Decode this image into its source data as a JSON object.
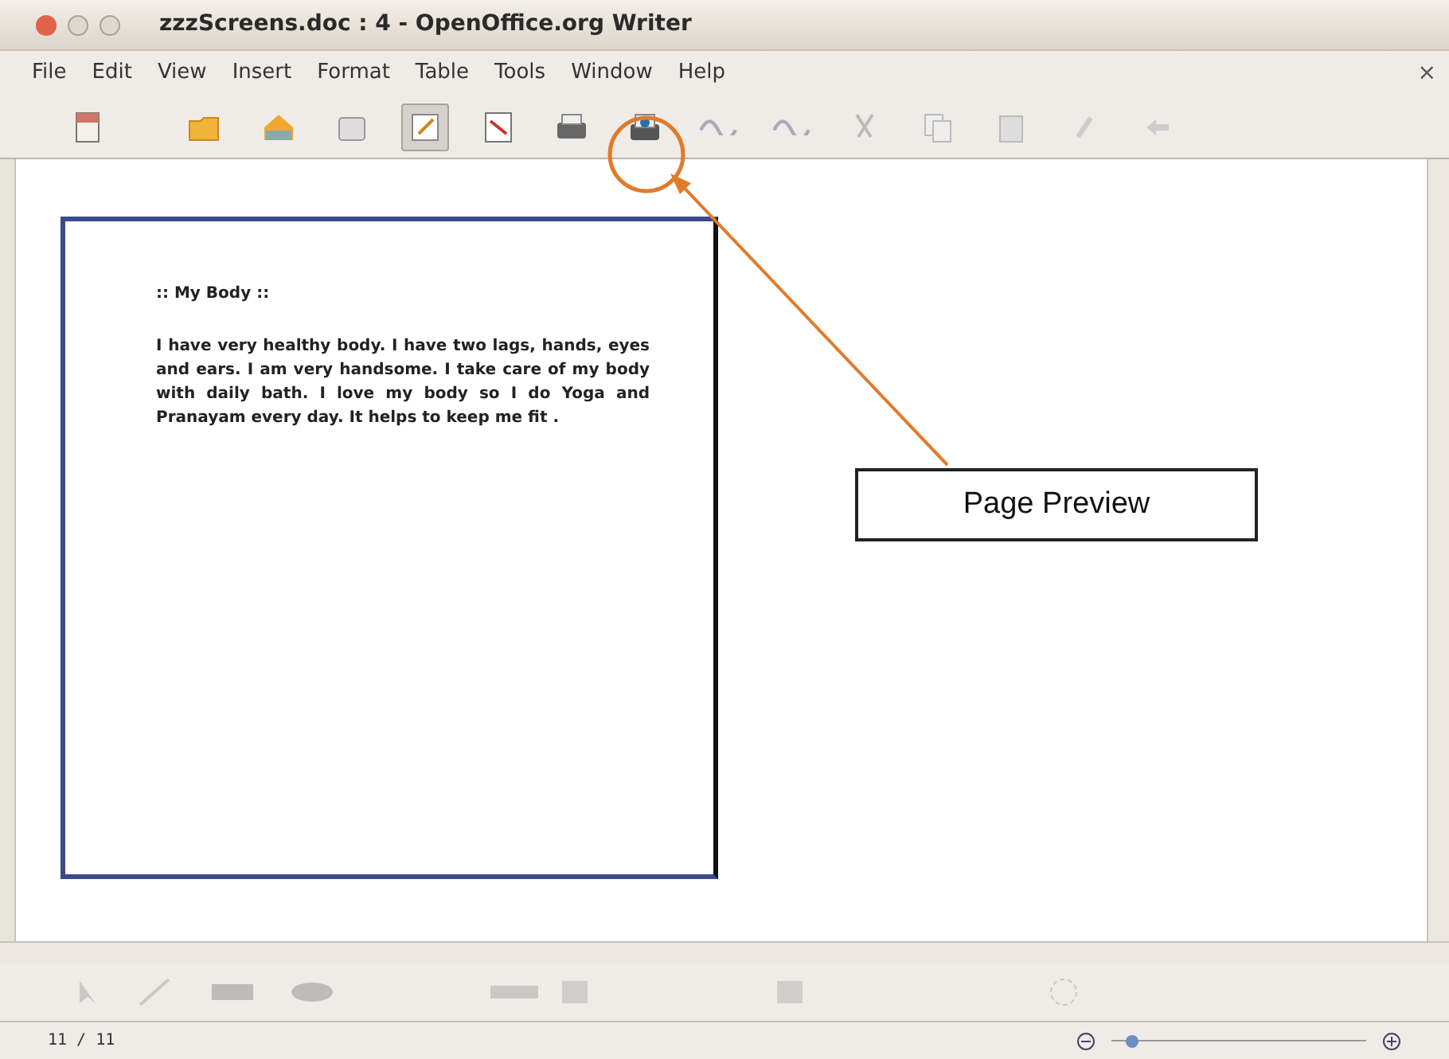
{
  "window": {
    "title": "zzzScreens.doc : 4 - OpenOffice.org Writer",
    "close_glyph": "×"
  },
  "menu": [
    {
      "label": "File"
    },
    {
      "label": "Edit"
    },
    {
      "label": "View"
    },
    {
      "label": "Insert"
    },
    {
      "label": "Format"
    },
    {
      "label": "Table"
    },
    {
      "label": "Tools"
    },
    {
      "label": "Window"
    },
    {
      "label": "Help"
    }
  ],
  "toolbar": [
    {
      "kind": "new",
      "selected": false
    },
    {
      "kind": "open",
      "selected": false
    },
    {
      "kind": "save",
      "selected": false
    },
    {
      "kind": "mail",
      "selected": false
    },
    {
      "kind": "edit",
      "selected": true
    },
    {
      "kind": "pdf",
      "selected": false
    },
    {
      "kind": "print",
      "selected": false
    },
    {
      "kind": "preview",
      "selected": false
    },
    {
      "kind": "spell",
      "selected": false
    },
    {
      "kind": "spell",
      "selected": false
    },
    {
      "kind": "cut",
      "selected": false
    },
    {
      "kind": "copy",
      "selected": false
    },
    {
      "kind": "paste",
      "selected": false
    },
    {
      "kind": "brush",
      "selected": false
    },
    {
      "kind": "undo",
      "selected": false
    }
  ],
  "document": {
    "heading": ":: My Body ::",
    "paragraph": "I have  very healthy body. I have two lags, hands, eyes and ears. I am very handsome. I take care of my body with daily bath. I love my body so I do Yoga and Pranayam  every day.  It helps to keep me fit ."
  },
  "callout": {
    "label": "Page Preview"
  },
  "status_bar": {
    "page": "11 / 11",
    "zoom": {
      "level": 0.08
    }
  }
}
